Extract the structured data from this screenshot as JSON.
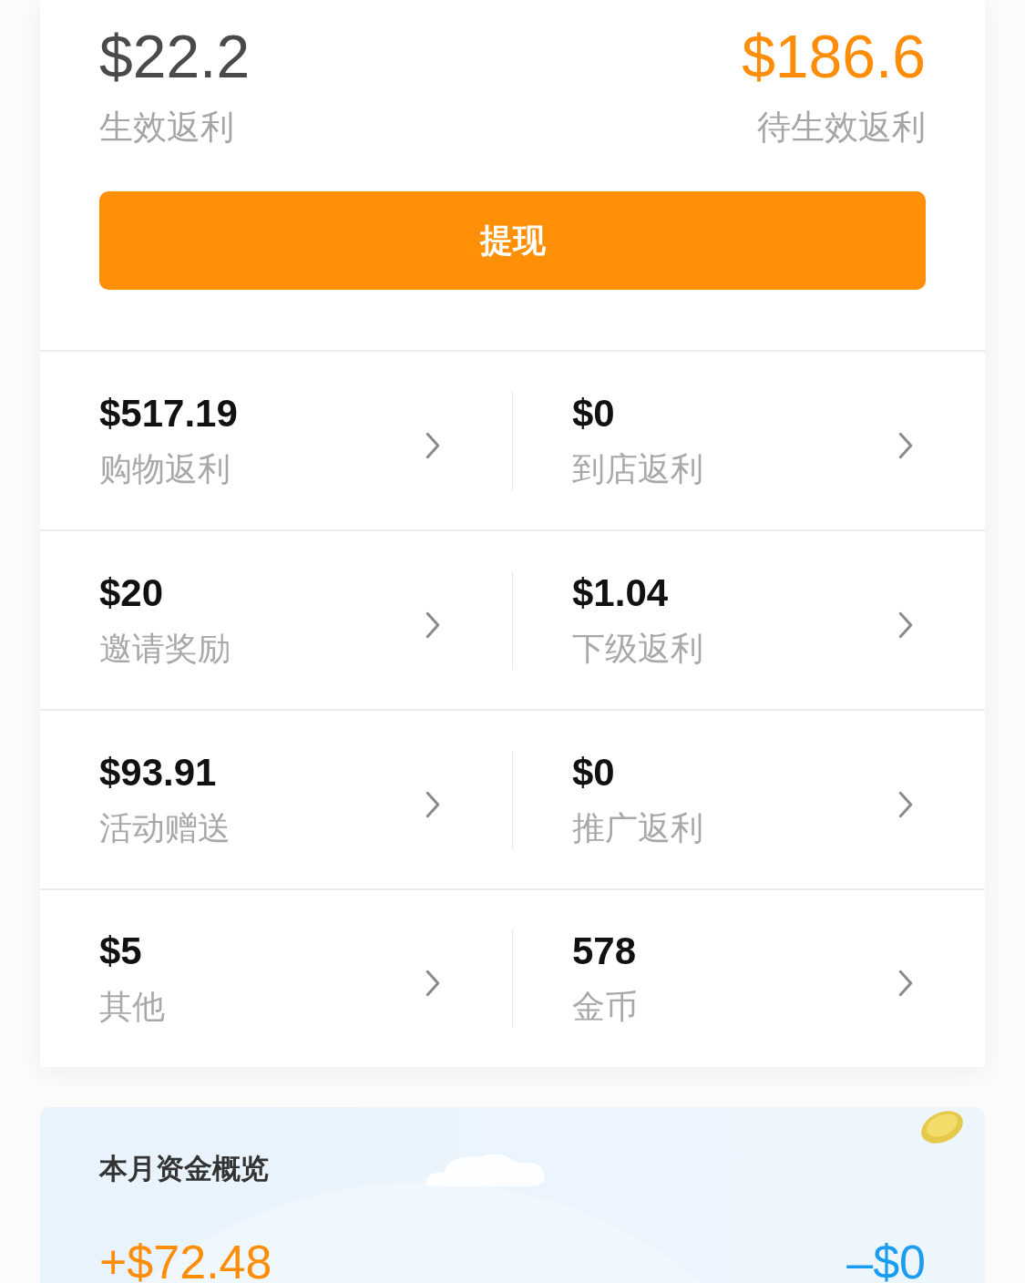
{
  "summary": {
    "effective": {
      "amount": "$22.2",
      "label": "生效返利"
    },
    "pending": {
      "amount": "$186.6",
      "label": "待生效返利"
    },
    "withdraw_button": "提现"
  },
  "breakdown": [
    {
      "amount": "$517.19",
      "label": "购物返利"
    },
    {
      "amount": "$0",
      "label": "到店返利"
    },
    {
      "amount": "$20",
      "label": "邀请奖励"
    },
    {
      "amount": "$1.04",
      "label": "下级返利"
    },
    {
      "amount": "$93.91",
      "label": "活动赠送"
    },
    {
      "amount": "$0",
      "label": "推广返利"
    },
    {
      "amount": "$5",
      "label": "其他"
    },
    {
      "amount": "578",
      "label": "金币"
    }
  ],
  "monthly_overview": {
    "title": "本月资金概览",
    "income": "+$72.48",
    "expense": "–$0"
  }
}
